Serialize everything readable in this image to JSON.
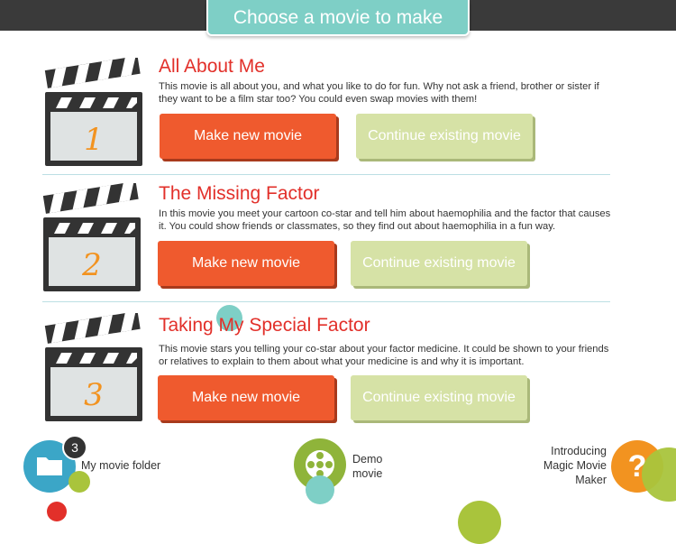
{
  "header": {
    "title": "Choose a movie to make"
  },
  "movies": [
    {
      "number": "1",
      "title": "All About Me",
      "description": "This movie is all about you, and what you like to do for fun. Why not ask a friend, brother or sister if they want to be a film star too? You could even swap movies with them!",
      "make_label": "Make new movie",
      "continue_label": "Continue existing movie"
    },
    {
      "number": "2",
      "title": "The Missing Factor",
      "description": "In this movie you meet your cartoon co-star and tell him about haemophilia and the factor that causes it. You could show friends or classmates, so they find out about haemophilia in a fun way.",
      "make_label": "Make new movie",
      "continue_label": "Continue existing movie"
    },
    {
      "number": "3",
      "title": "Taking My Special Factor",
      "description": "This movie stars you telling your co-star about your factor medicine. It could be shown to your friends or relatives to explain to them about what your medicine is and why it is important.",
      "make_label": "Make new movie",
      "continue_label": "Continue existing movie"
    }
  ],
  "footer": {
    "folder_label": "My movie folder",
    "folder_count": "3",
    "demo_label_line1": "Demo",
    "demo_label_line2": "movie",
    "intro_line1": "Introducing",
    "intro_line2": "Magic Movie",
    "intro_line3": "Maker",
    "help_symbol": "?"
  },
  "colors": {
    "accent": "#e2302a",
    "make_button": "#ef5a2e",
    "continue_button": "#d6e2a6",
    "teal": "#7ecfc6",
    "lime": "#8fb43a",
    "orange": "#f29320"
  }
}
